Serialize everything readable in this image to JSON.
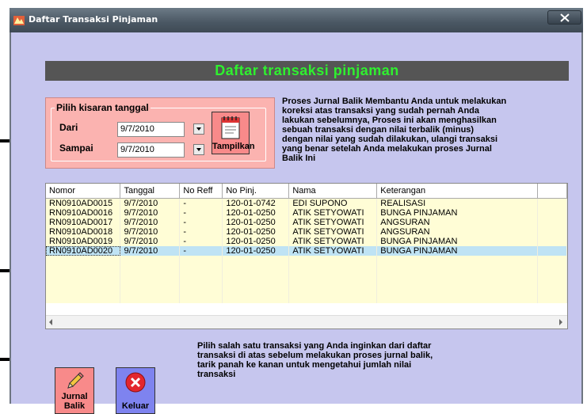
{
  "window": {
    "title": "Daftar Transaksi Pinjaman",
    "close_glyph": "✕"
  },
  "header": {
    "title": "Daftar transaksi pinjaman"
  },
  "date_range": {
    "legend": "Pilih kisaran tanggal",
    "from_label": "Dari",
    "from_value": "9/7/2010",
    "to_label": "Sampai",
    "to_value": "9/7/2010",
    "show_button_label": "Tampilkan"
  },
  "info_top": [
    "Proses Jurnal Balik Membantu Anda untuk melakukan",
    "koreksi atas transaksi yang sudah pernah Anda",
    "lakukan sebelumnya, Proses ini akan menghasilkan",
    "sebuah transaksi dengan nilai terbalik (minus)",
    "dengan nilai yang sudah dilakukan, ulangi transaksi",
    "yang benar setelah Anda melakukan proses Jurnal",
    "Balik Ini"
  ],
  "table": {
    "columns": [
      "Nomor",
      "Tanggal",
      "No Reff",
      "No Pinj.",
      "Nama",
      "Keterangan"
    ],
    "rows": [
      [
        "RN0910AD0015",
        "9/7/2010",
        "-",
        "120-01-0742",
        "EDI SUPONO",
        "REALISASI"
      ],
      [
        "RN0910AD0016",
        "9/7/2010",
        "-",
        "120-01-0250",
        "ATIK SETYOWATI",
        "BUNGA PINJAMAN"
      ],
      [
        "RN0910AD0017",
        "9/7/2010",
        "-",
        "120-01-0250",
        "ATIK SETYOWATI",
        "ANGSURAN"
      ],
      [
        "RN0910AD0018",
        "9/7/2010",
        "-",
        "120-01-0250",
        "ATIK SETYOWATI",
        "ANGSURAN"
      ],
      [
        "RN0910AD0019",
        "9/7/2010",
        "-",
        "120-01-0250",
        "ATIK SETYOWATI",
        "BUNGA PINJAMAN"
      ],
      [
        "RN0910AD0020",
        "9/7/2010",
        "-",
        "120-01-0250",
        "ATIK SETYOWATI",
        "BUNGA PINJAMAN"
      ]
    ],
    "selected_row": 5
  },
  "buttons": {
    "journal_line1": "Jurnal",
    "journal_line2": "Balik",
    "exit": "Keluar"
  },
  "info_bottom": [
    "Pilih salah satu transaksi yang Anda inginkan dari daftar",
    "transaksi di atas sebelum melakukan proses jurnal balik,",
    "tarik panah ke kanan untuk mengetahui jumlah nilai",
    "transaksi"
  ],
  "colors": {
    "header_bg": "#555555",
    "header_text": "#2ff02f",
    "client_bg": "#c6c6ee",
    "date_box_bg": "#fbb3b0",
    "selected_row_bg": "#bfe3f4",
    "row_bg": "#fffdd6"
  }
}
